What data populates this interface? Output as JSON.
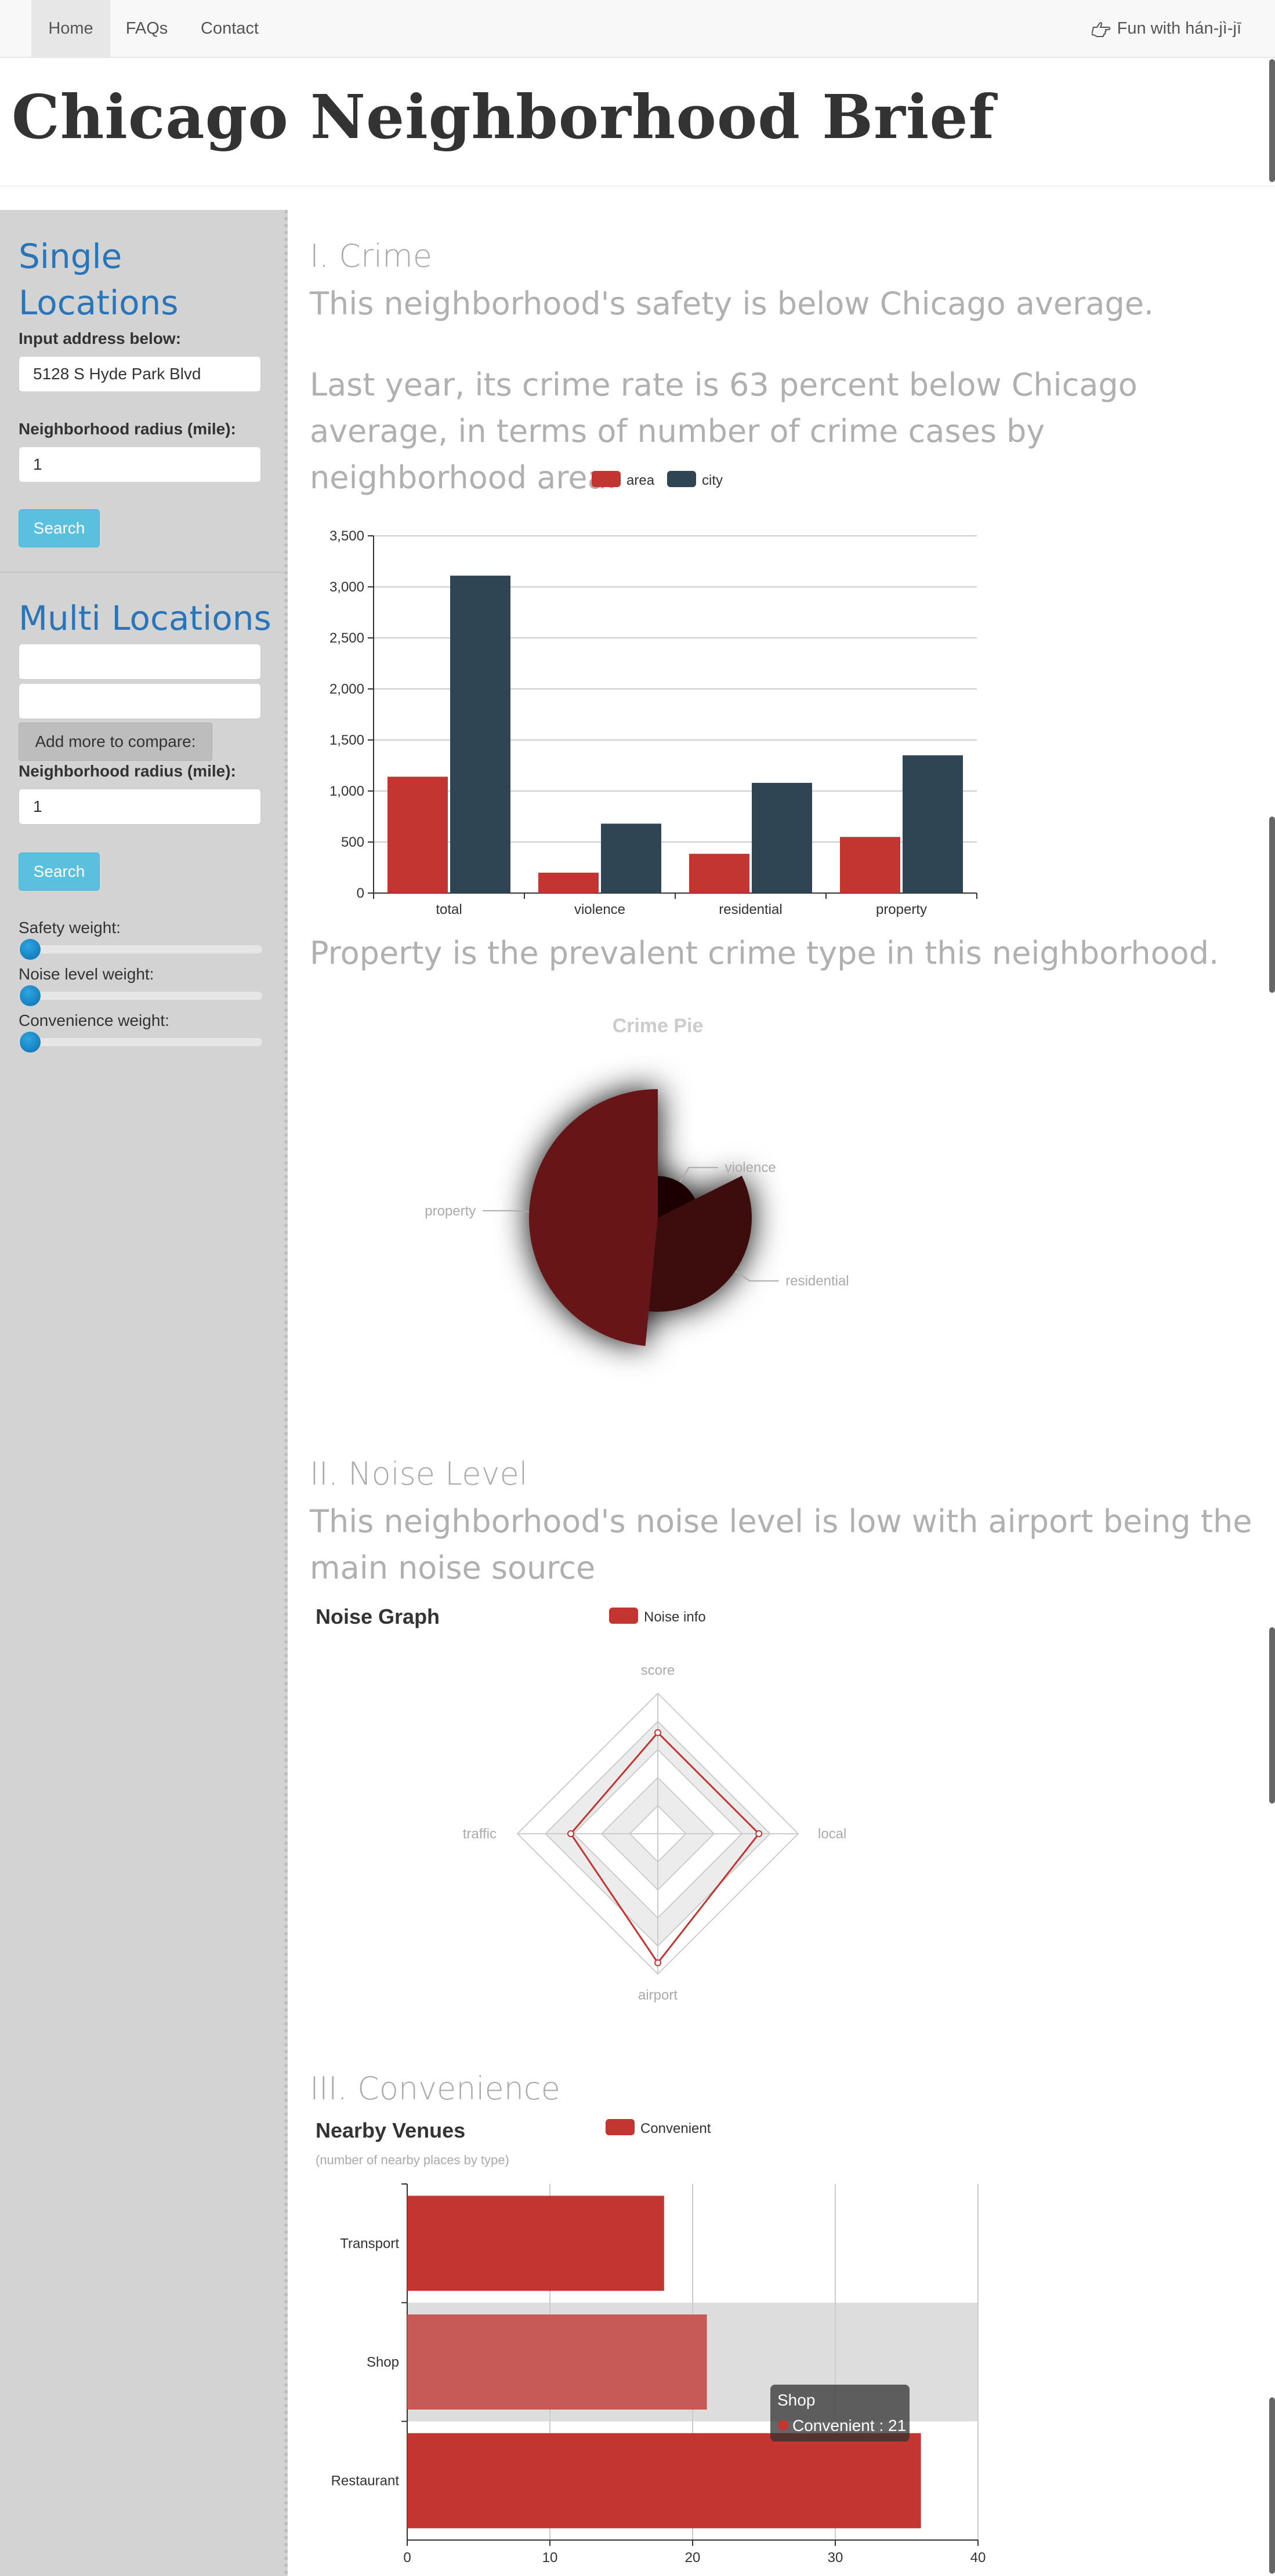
{
  "nav": {
    "items": [
      "Home",
      "FAQs",
      "Contact"
    ],
    "right_link": "Fun with hán-jì-jī",
    "right_icon": "hand-pointing-icon"
  },
  "page_title": "Chicago Neighborhood Brief",
  "sidebar": {
    "single": {
      "title": "Single Locations",
      "address_label": "Input address below:",
      "address_value": "5128 S Hyde Park Blvd",
      "radius_label": "Neighborhood radius (mile):",
      "radius_value": "1",
      "search_label": "Search"
    },
    "multi": {
      "title": "Multi Locations",
      "add_label": "Add more to compare:",
      "radius_label": "Neighborhood radius (mile):",
      "radius_value": "1",
      "search_label": "Search",
      "safety_label": "Safety weight:",
      "noise_label": "Noise level weight:",
      "convenience_label": "Convenience weight:",
      "safety_weight": 0,
      "noise_weight": 0,
      "convenience_weight": 0
    }
  },
  "crime": {
    "heading": "I. Crime",
    "summary": "This neighborhood's safety is below Chicago average.",
    "detail": "Last year, its crime rate is 63 percent below Chicago average, in terms of number of crime cases by neighborhood area.",
    "prevalent": "Property is the prevalent crime type in this neighborhood."
  },
  "noise": {
    "heading": "II. Noise Level",
    "summary": "This neighborhood's noise level is low with airport being the main noise source"
  },
  "convenience": {
    "heading": "III. Convenience"
  },
  "colors": {
    "area": "#c23531",
    "city": "#2f4554",
    "accent": "#5bc0de",
    "link": "#2a74b8"
  },
  "chart_data": [
    {
      "type": "bar",
      "categories": [
        "total",
        "violence",
        "residential",
        "property"
      ],
      "series": [
        {
          "name": "area",
          "values": [
            1140,
            200,
            385,
            550
          ]
        },
        {
          "name": "city",
          "values": [
            3110,
            680,
            1080,
            1350
          ]
        }
      ],
      "ylim": [
        0,
        3500
      ],
      "yticks": [
        "0",
        "500",
        "1,000",
        "1,500",
        "2,000",
        "2,500",
        "3,000",
        "3,500"
      ],
      "legend": "top-center",
      "grid": true
    },
    {
      "type": "pie",
      "title": "Crime Pie",
      "categories": [
        "violence",
        "residential",
        "property"
      ],
      "values": [
        200,
        385,
        550
      ],
      "style": "rose"
    },
    {
      "type": "radar",
      "title": "Noise Graph",
      "legend": [
        "Noise info"
      ],
      "indicators": [
        "score",
        "local",
        "airport",
        "traffic"
      ],
      "values": [
        0.72,
        0.72,
        0.92,
        0.62
      ]
    },
    {
      "type": "bar",
      "orientation": "horizontal",
      "title": "Nearby Venues",
      "subtitle": "(number of nearby places by type)",
      "legend": [
        "Convenient"
      ],
      "categories": [
        "Transport",
        "Shop",
        "Restaurant"
      ],
      "values": [
        18,
        21,
        36
      ],
      "xlim": [
        0,
        40
      ],
      "xticks": [
        "0",
        "10",
        "20",
        "30",
        "40"
      ],
      "tooltip": {
        "title": "Shop",
        "text": "Convenient : 21"
      }
    }
  ]
}
